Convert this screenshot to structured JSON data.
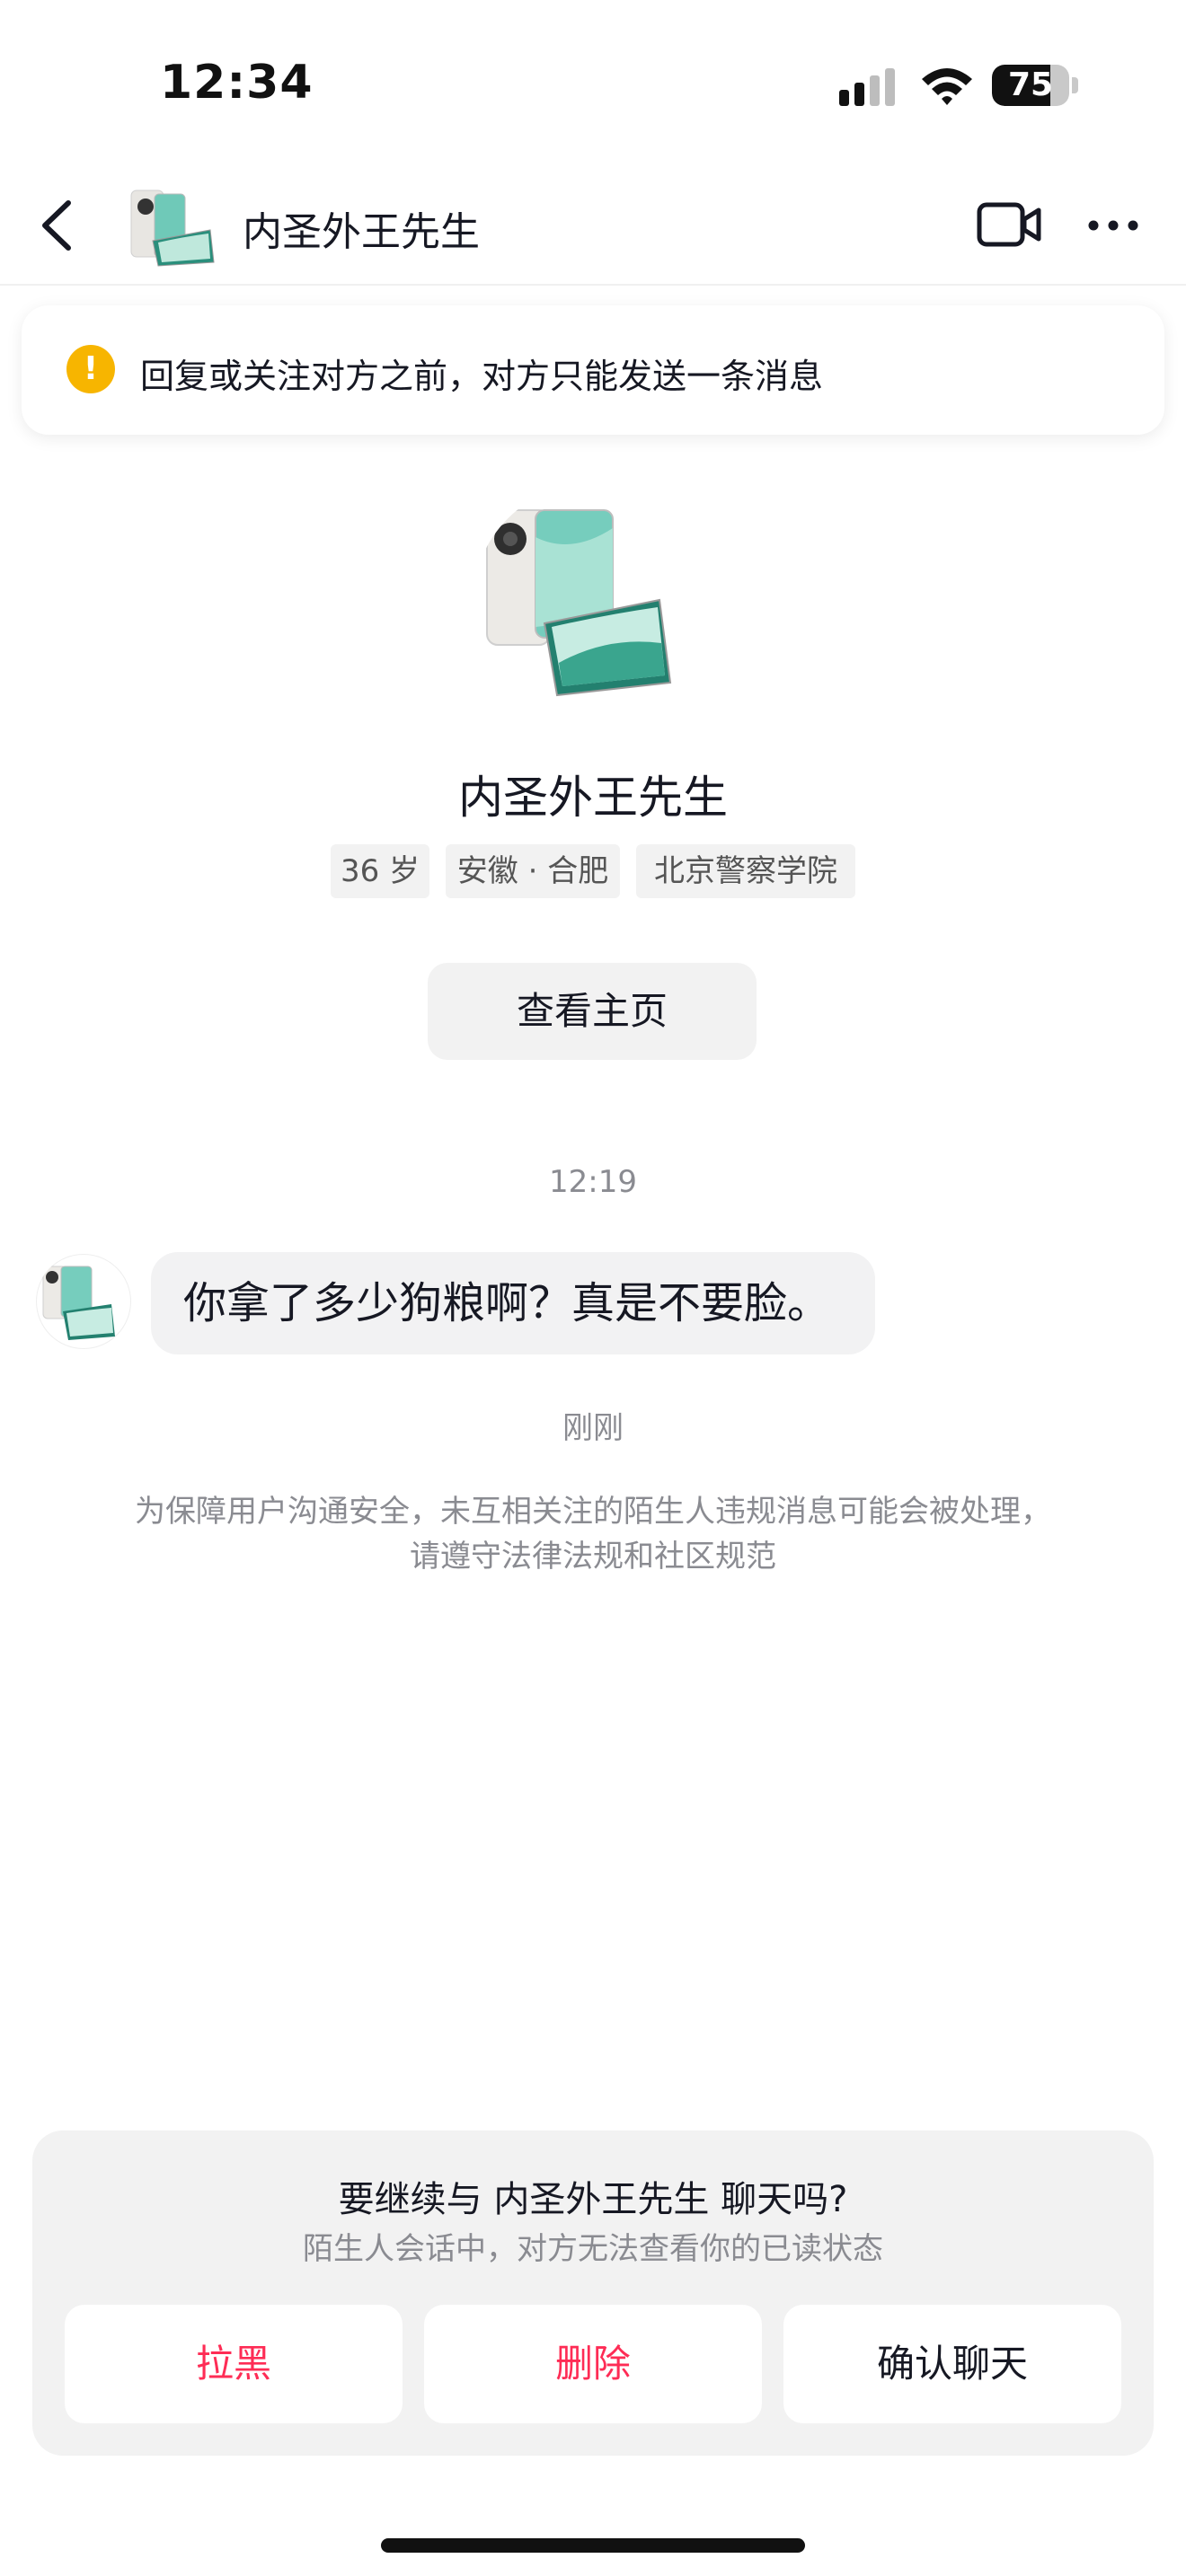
{
  "status_bar": {
    "time": "12:34",
    "battery": 75,
    "battery_label": "75"
  },
  "header": {
    "name": "内圣外王先生",
    "back_icon": "chevron-left-icon",
    "video_icon": "video-camera-icon",
    "more_icon": "more-dots-icon"
  },
  "notice": {
    "icon": "exclamation-icon",
    "text": "回复或关注对方之前，对方只能发送一条消息",
    "icon_color": "#f7b500"
  },
  "profile": {
    "name": "内圣外王先生",
    "tags": [
      "36 岁",
      "安徽 · 合肥",
      "北京警察学院"
    ],
    "view_home_label": "查看主页"
  },
  "chat": {
    "timestamp_1": "12:19",
    "message": "你拿了多少狗粮啊？真是不要脸。",
    "timestamp_2": "刚刚",
    "safety_notice": "为保障用户沟通安全，未互相关注的陌生人违规消息可能会被处理，请遵守法律法规和社区规范"
  },
  "prompt": {
    "title": "要继续与 内圣外王先生 聊天吗?",
    "subtitle": "陌生人会话中，对方无法查看你的已读状态",
    "block_label": "拉黑",
    "delete_label": "删除",
    "confirm_label": "确认聊天",
    "danger_color": "#fe2c55"
  }
}
